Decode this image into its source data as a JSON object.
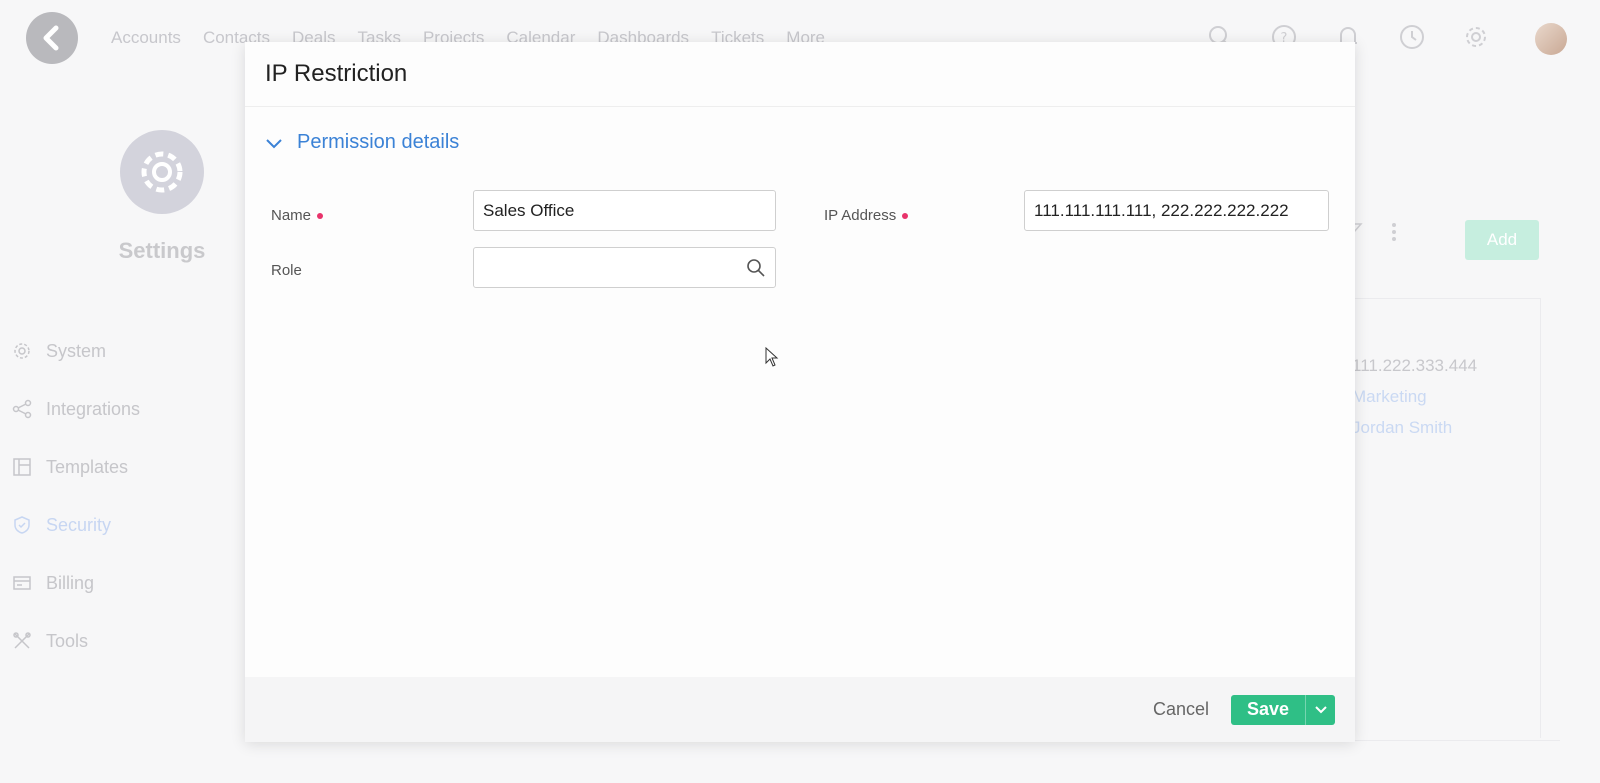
{
  "nav": {
    "items": [
      "Accounts",
      "Contacts",
      "Deals",
      "Tasks",
      "Projects",
      "Calendar",
      "Dashboards",
      "Tickets",
      "More"
    ]
  },
  "settings": {
    "title": "Settings",
    "sidebar": [
      {
        "label": "System",
        "icon": "gear-icon"
      },
      {
        "label": "Integrations",
        "icon": "share-icon"
      },
      {
        "label": "Templates",
        "icon": "layout-icon"
      },
      {
        "label": "Security",
        "icon": "shield-icon",
        "active": true
      },
      {
        "label": "Billing",
        "icon": "card-icon"
      },
      {
        "label": "Tools",
        "icon": "tools-icon"
      }
    ]
  },
  "background": {
    "add_label": "Add",
    "detail": [
      "111.222.333.444",
      "Marketing",
      "Jordan Smith"
    ]
  },
  "modal": {
    "title": "IP Restriction",
    "section_label": "Permission details",
    "fields": {
      "name_label": "Name",
      "name_value": "Sales Office",
      "ip_label": "IP Address",
      "ip_value": "111.111.111.111, 222.222.222.222",
      "role_label": "Role",
      "role_value": ""
    },
    "footer": {
      "cancel_label": "Cancel",
      "save_label": "Save"
    }
  },
  "colors": {
    "accent": "#3b82d6",
    "save": "#2fbf86",
    "required": "#e8336b"
  }
}
